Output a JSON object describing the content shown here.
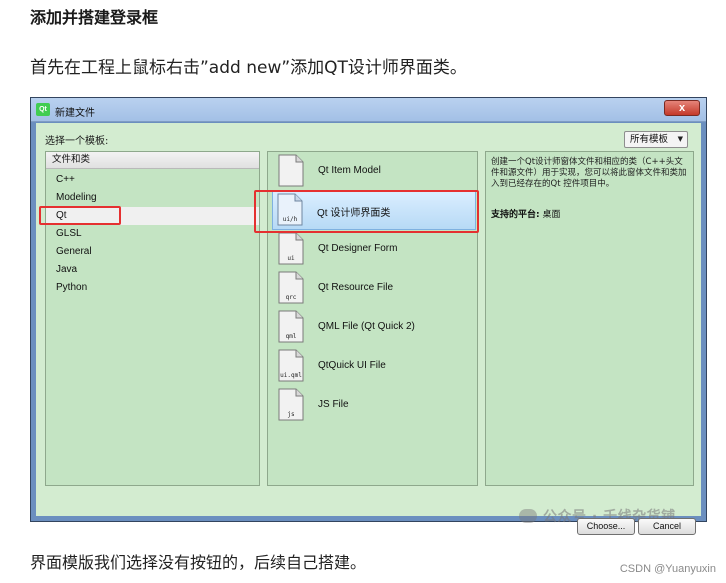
{
  "article": {
    "heading": "添加并搭建登录框",
    "intro": "首先在工程上鼠标右击”add new”添加QT设计师界面类。",
    "outro": "界面模版我们选择没有按钮的，后续自己搭建。",
    "credit": "CSDN @Yuanyuxin"
  },
  "dialog": {
    "title": "新建文件",
    "app_icon": "Qt",
    "close_label": "x",
    "choose_label": "选择一个模板:",
    "filter_value": "所有模板",
    "category_group": "文件和类",
    "categories": [
      {
        "label": "C++",
        "selected": false
      },
      {
        "label": "Modeling",
        "selected": false
      },
      {
        "label": "Qt",
        "selected": true
      },
      {
        "label": "GLSL",
        "selected": false
      },
      {
        "label": "General",
        "selected": false
      },
      {
        "label": "Java",
        "selected": false
      },
      {
        "label": "Python",
        "selected": false
      }
    ],
    "templates": [
      {
        "label": "Qt Item Model",
        "icon_tag": "",
        "selected": false
      },
      {
        "label": "Qt 设计师界面类",
        "icon_tag": "ui/h",
        "selected": true
      },
      {
        "label": "Qt Designer Form",
        "icon_tag": "ui",
        "selected": false
      },
      {
        "label": "Qt Resource File",
        "icon_tag": "qrc",
        "selected": false
      },
      {
        "label": "QML File (Qt Quick 2)",
        "icon_tag": "qml",
        "selected": false
      },
      {
        "label": "QtQuick UI File",
        "icon_tag": "ui.qml",
        "selected": false
      },
      {
        "label": "JS File",
        "icon_tag": "js",
        "selected": false
      }
    ],
    "description": "创建一个Qt设计师窗体文件和相应的类（C++头文件和源文件）用于实现，您可以将此窗体文件和类加入到已经存在的Qt 控件项目中。",
    "platform_label": "支持的平台:",
    "platform_value": "桌面",
    "choose_button": "Choose...",
    "cancel_button": "Cancel"
  },
  "watermark": "公众号 · 千线杂货铺",
  "colors": {
    "highlight_box": "#e53030",
    "pane_green": "#c4e4c3",
    "selection_blue": "#b7daf6"
  }
}
